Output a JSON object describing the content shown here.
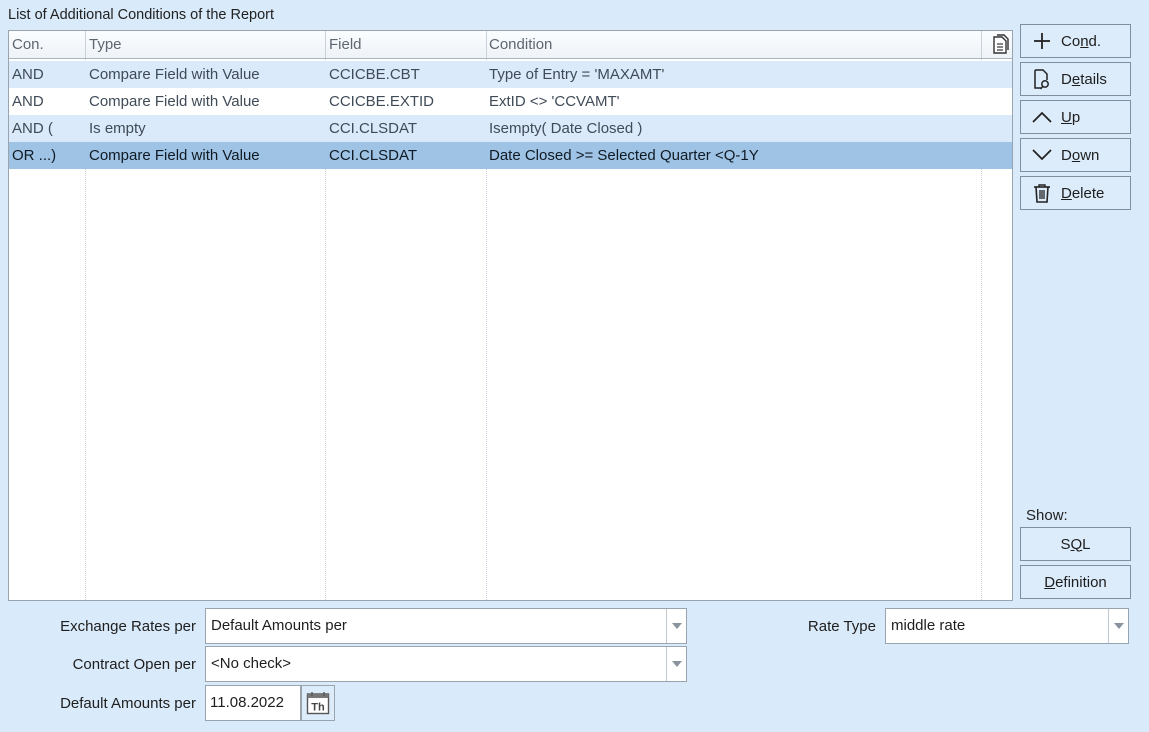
{
  "list_title": "List of Additional Conditions of the Report",
  "grid": {
    "columns": [
      "Con.",
      "Type",
      "Field",
      "Condition"
    ],
    "rows": [
      {
        "con": "AND",
        "type": "Compare Field with Value",
        "field": "CCICBE.CBT",
        "condition": "Type of Entry = 'MAXAMT'"
      },
      {
        "con": "AND",
        "type": "Compare Field with Value",
        "field": "CCICBE.EXTID",
        "condition": "ExtID <> 'CCVAMT'"
      },
      {
        "con": "AND (",
        "type": "Is empty",
        "field": "CCI.CLSDAT",
        "condition": "Isempty( Date Closed )"
      },
      {
        "con": "OR ...)",
        "type": "Compare Field with Value",
        "field": "CCI.CLSDAT",
        "condition": "Date Closed >= Selected Quarter <Q-1Y"
      }
    ],
    "selected_row": 3
  },
  "buttons": {
    "cond": {
      "pre": "Co",
      "key": "n",
      "post": "d."
    },
    "details": {
      "pre": "D",
      "key": "e",
      "post": "tails"
    },
    "up": {
      "pre": "",
      "key": "U",
      "post": "p"
    },
    "down": {
      "pre": "D",
      "key": "o",
      "post": "wn"
    },
    "delete": {
      "pre": "",
      "key": "D",
      "post": "elete"
    }
  },
  "show": {
    "label": "Show:",
    "sql": {
      "pre": "S",
      "key": "Q",
      "post": "L"
    },
    "definition": {
      "pre": "",
      "key": "D",
      "post": "efinition"
    }
  },
  "form": {
    "exchange_rates": {
      "label": "Exchange Rates per",
      "value": "Default Amounts per"
    },
    "rate_type": {
      "label": "Rate Type",
      "value": "middle rate"
    },
    "contract_open": {
      "label": "Contract Open per",
      "value": "<No check>"
    },
    "default_amounts": {
      "label": "Default Amounts per",
      "value": "11.08.2022",
      "calendar_text": "Th"
    }
  },
  "colors": {
    "background": "#d9eafa",
    "row_alt": "#daeafa",
    "row_selected": "#9fc3e4",
    "button_border": "#7f8fa0"
  },
  "icons": [
    "copy-icon",
    "plus-icon",
    "document-search-icon",
    "chevron-up-icon",
    "chevron-down-icon",
    "trash-icon",
    "dropdown-arrow-icon",
    "calendar-icon"
  ]
}
